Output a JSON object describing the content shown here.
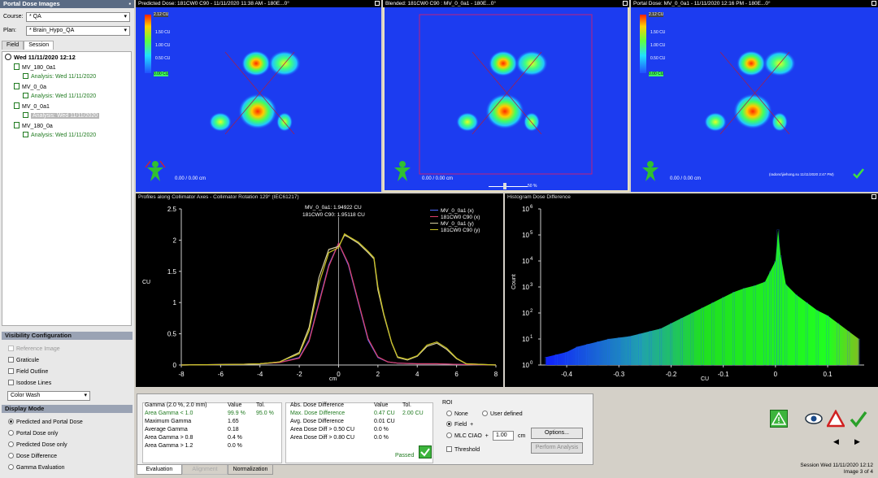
{
  "left": {
    "title": "Portal Dose Images",
    "pin": "&#x1F4CC;",
    "course_label": "Course:",
    "course_value": "* QA",
    "plan_label": "Plan:",
    "plan_value": "* Brain_Hypo_QA",
    "tab_field": "Field",
    "tab_session": "Session",
    "tree": [
      {
        "text": "Wed 11/11/2020 12:12",
        "kind": "root"
      },
      {
        "text": "MV_180_0a1",
        "kind": "field"
      },
      {
        "text": "Analysis: Wed 11/11/2020",
        "kind": "analysis"
      },
      {
        "text": "MV_0_0a",
        "kind": "field"
      },
      {
        "text": "Analysis: Wed 11/11/2020",
        "kind": "analysis"
      },
      {
        "text": "MV_0_0a1",
        "kind": "field"
      },
      {
        "text": "Analysis: Wed 11/11/2020",
        "kind": "analysis-selected"
      },
      {
        "text": "MV_180_0a",
        "kind": "field"
      },
      {
        "text": "Analysis: Wed 11/11/2020",
        "kind": "analysis"
      }
    ],
    "visibility_title": "Visibility Configuration",
    "visibility": [
      {
        "label": "Reference Image",
        "checked": false,
        "disabled": true
      },
      {
        "label": "Graticule",
        "checked": false
      },
      {
        "label": "Field Outline",
        "checked": false
      },
      {
        "label": "Isodose Lines",
        "checked": false
      }
    ],
    "color_mode": "Color Wash",
    "display_title": "Display Mode",
    "display": [
      {
        "label": "Predicted and Portal Dose",
        "on": true
      },
      {
        "label": "Portal Dose only",
        "on": false
      },
      {
        "label": "Predicted Dose only",
        "on": false
      },
      {
        "label": "Dose Difference",
        "on": false
      },
      {
        "label": "Gamma Evaluation",
        "on": false
      }
    ]
  },
  "images": {
    "predicted_title": "Predicted Dose: 181CW0 C90 - 11/11/2020 11:38 AM - 180E...0°",
    "blended_title": "Blended: 181CW0 C90 : MV_0_0a1 - 180E...0°",
    "portal_title": "Portal Dose: MV_0_0a1 - 11/11/2020 12:16 PM - 180E...0°",
    "scale_top": "2.12 CU",
    "scale_labels": [
      "1.50 CU",
      "1.00 CU",
      "0.50 CU"
    ],
    "scale_bottom": "0.00 CU",
    "coord": "0.00 / 0.00 cm",
    "blend_pct": "50 %",
    "portal_user": "(radonc\\jiehong.su 11/11/2020 2:47 PM)"
  },
  "profile": {
    "title": "Profiles along Collimator Axes - Collimator Rotation 129° (IEC61217)",
    "readout1": "MV_0_0a1: 1.94922 CU",
    "readout2": "181CW0 C90: 1.95118 CU",
    "ylabel": "CU",
    "xlabel": "cm",
    "legend": [
      "MV_0_0a1 (x)",
      "181CW0 C90 (x)",
      "MV_0_0a1 (y)",
      "181CW0 C90 (y)"
    ],
    "series_colors": [
      "#4f6bff",
      "#e0406a",
      "#d8d0a0",
      "#c8c020"
    ]
  },
  "histogram": {
    "title": "Histogram Dose Difference",
    "ylabel": "Count",
    "xlabel": "CU"
  },
  "chart_data": [
    {
      "type": "line",
      "title": "Profiles along Collimator Axes - Collimator Rotation 129° (IEC61217)",
      "xlabel": "cm",
      "ylabel": "CU",
      "xlim": [
        -8,
        8
      ],
      "ylim": [
        0,
        2.5
      ],
      "xticks": [
        -8,
        -6,
        -4,
        -2,
        0,
        2,
        4,
        6,
        8
      ],
      "yticks": [
        0,
        0.5,
        1,
        1.5,
        2,
        2.5
      ],
      "grid": false,
      "legend_position": "top-right",
      "series": [
        {
          "name": "MV_0_0a1 (x)",
          "color": "#4f6bff",
          "x": [
            -8,
            -5,
            -4,
            -3,
            -2,
            -1.5,
            -1,
            -0.5,
            0,
            0.5,
            1,
            1.5,
            2,
            2.5,
            3,
            4,
            5,
            6,
            8
          ],
          "y": [
            0,
            0.01,
            0.02,
            0.04,
            0.12,
            0.4,
            1.0,
            1.6,
            1.95,
            1.6,
            1.0,
            0.4,
            0.12,
            0.05,
            0.03,
            0.02,
            0.02,
            0.01,
            0
          ]
        },
        {
          "name": "181CW0 C90 (x)",
          "color": "#e0406a",
          "x": [
            -8,
            -5,
            -4,
            -3,
            -2,
            -1.5,
            -1,
            -0.5,
            0,
            0.5,
            1,
            1.5,
            2,
            2.5,
            3,
            4,
            5,
            6,
            8
          ],
          "y": [
            0,
            0.01,
            0.02,
            0.04,
            0.11,
            0.38,
            0.98,
            1.58,
            1.95,
            1.62,
            1.02,
            0.42,
            0.13,
            0.05,
            0.03,
            0.02,
            0.02,
            0.01,
            0
          ]
        },
        {
          "name": "MV_0_0a1 (y)",
          "color": "#d8d0a0",
          "x": [
            -8,
            -5,
            -4,
            -3,
            -2,
            -1.5,
            -1,
            -0.5,
            0,
            0.3,
            0.5,
            1,
            1.5,
            1.8,
            2,
            2.3,
            2.7,
            3,
            3.5,
            4,
            4.5,
            5,
            5.5,
            6,
            6.5,
            8
          ],
          "y": [
            0,
            0.01,
            0.02,
            0.05,
            0.2,
            0.6,
            1.4,
            1.85,
            1.9,
            2.08,
            2.05,
            1.95,
            1.8,
            1.7,
            1.2,
            0.8,
            0.35,
            0.12,
            0.08,
            0.14,
            0.3,
            0.35,
            0.25,
            0.1,
            0.02,
            0
          ]
        },
        {
          "name": "181CW0 C90 (y)",
          "color": "#c8c020",
          "x": [
            -8,
            -5,
            -4,
            -3,
            -2,
            -1.5,
            -1,
            -0.5,
            0,
            0.3,
            0.5,
            1,
            1.5,
            1.8,
            2,
            2.3,
            2.7,
            3,
            3.5,
            4,
            4.5,
            5,
            5.5,
            6,
            6.5,
            8
          ],
          "y": [
            0,
            0.01,
            0.02,
            0.05,
            0.18,
            0.55,
            1.3,
            1.8,
            1.88,
            2.1,
            2.06,
            1.97,
            1.82,
            1.72,
            1.25,
            0.82,
            0.36,
            0.13,
            0.09,
            0.15,
            0.32,
            0.37,
            0.27,
            0.11,
            0.02,
            0
          ]
        }
      ]
    },
    {
      "type": "bar",
      "title": "Histogram Dose Difference",
      "xlabel": "CU",
      "ylabel": "Count",
      "xlim": [
        -0.45,
        0.17
      ],
      "ylim_log10": [
        0,
        6
      ],
      "xticks": [
        -0.4,
        -0.3,
        -0.2,
        -0.1,
        0,
        0.1
      ],
      "ytick_labels": [
        "10^0",
        "10^1",
        "10^2",
        "10^3",
        "10^4",
        "10^5",
        "10^6"
      ],
      "log_scale_y": true,
      "x": [
        -0.44,
        -0.42,
        -0.4,
        -0.38,
        -0.36,
        -0.34,
        -0.32,
        -0.3,
        -0.28,
        -0.26,
        -0.24,
        -0.22,
        -0.2,
        -0.18,
        -0.16,
        -0.14,
        -0.12,
        -0.1,
        -0.08,
        -0.06,
        -0.04,
        -0.02,
        -0.01,
        0,
        0.005,
        0.01,
        0.02,
        0.04,
        0.06,
        0.08,
        0.1,
        0.12,
        0.14,
        0.16
      ],
      "log10_count": [
        0.3,
        0.4,
        0.5,
        0.7,
        0.8,
        0.9,
        1.0,
        1.05,
        1.1,
        1.2,
        1.3,
        1.4,
        1.6,
        1.8,
        2.0,
        2.2,
        2.4,
        2.6,
        2.8,
        2.95,
        3.05,
        3.2,
        3.6,
        4.0,
        5.2,
        4.2,
        3.1,
        2.7,
        2.4,
        2.1,
        1.9,
        1.6,
        1.3,
        1.0
      ]
    }
  ],
  "eval": {
    "gamma_title": "Gamma (2.0 %, 2.0 mm)",
    "value_hdr": "Value",
    "tol_hdr": "Tol.",
    "gamma_rows": [
      {
        "label": "Area Gamma < 1.0",
        "value": "99.9 %",
        "tol": "95.0 %",
        "green": true
      },
      {
        "label": "Maximum Gamma",
        "value": "1.65",
        "tol": "",
        "green": false
      },
      {
        "label": "Average Gamma",
        "value": "0.18",
        "tol": "",
        "green": false
      },
      {
        "label": "Area Gamma > 0.8",
        "value": "0.4 %",
        "tol": "",
        "green": false
      },
      {
        "label": "Area Gamma > 1.2",
        "value": "0.0 %",
        "tol": "",
        "green": false
      }
    ],
    "abs_title": "Abs. Dose Difference",
    "abs_rows": [
      {
        "label": "Max. Dose Difference",
        "value": "0.47 CU",
        "tol": "2.00 CU",
        "green": true
      },
      {
        "label": "Avg. Dose Difference",
        "value": "0.01 CU",
        "tol": "",
        "green": false
      },
      {
        "label": "Area Dose Diff > 0.50 CU",
        "value": "0.0 %",
        "tol": "",
        "green": false
      },
      {
        "label": "Area Dose Diff > 0.80 CU",
        "value": "0.0 %",
        "tol": "",
        "green": false
      }
    ],
    "passed": "Passed",
    "roi_title": "ROI",
    "roi_none": "None",
    "roi_user": "User defined",
    "roi_field": "Field",
    "roi_mlc": "MLC CIAO",
    "roi_plus": "+",
    "roi_margin": "1.00",
    "roi_unit": "cm",
    "threshold": "Threshold",
    "options": "Options...",
    "perform": "Perform Analysis",
    "tabs": [
      "Evaluation",
      "Alignment",
      "Normalization"
    ]
  },
  "status": {
    "session": "Session Wed 11/11/2020 12:12",
    "image": "Image 3 of 4"
  }
}
